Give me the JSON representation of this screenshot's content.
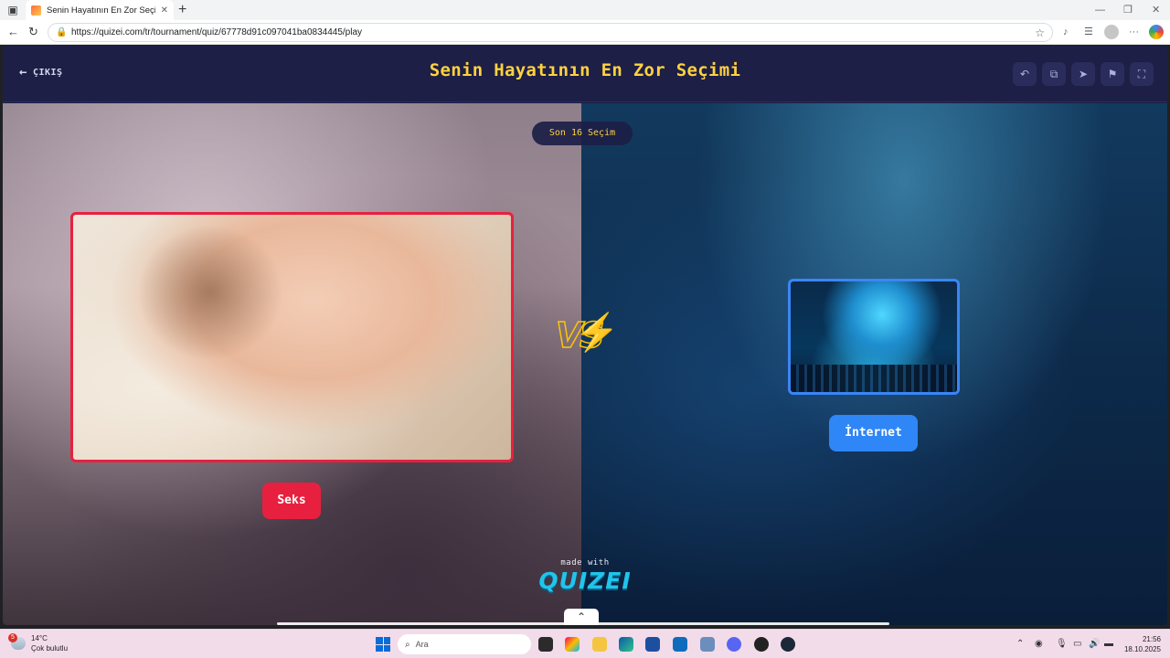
{
  "browser": {
    "tab_title": "Senin Hayatının En Zor Seçimi - Q",
    "url": "https://quizei.com/tr/tournament/quiz/67778d91c097041ba0834445/play"
  },
  "header": {
    "exit_label": "ÇIKIŞ",
    "title": "Senin Hayatının En Zor Seçimi",
    "icons": [
      "undo-icon",
      "share-icon",
      "send-icon",
      "flag-icon",
      "fullscreen-icon"
    ]
  },
  "round": {
    "label": "Son 16 Seçim"
  },
  "choices": [
    {
      "label": "Seks",
      "color": "#e8203f"
    },
    {
      "label": "İnternet",
      "color": "#2f86f6"
    }
  ],
  "vs_label": "VS",
  "footer": {
    "made_with": "made with",
    "brand": "QUIZEI"
  },
  "taskbar": {
    "weather_temp": "14°C",
    "weather_desc": "Çok bulutlu",
    "weather_badge": "5",
    "search_placeholder": "Ara",
    "time": "21:56",
    "date": "18.10.2025"
  }
}
